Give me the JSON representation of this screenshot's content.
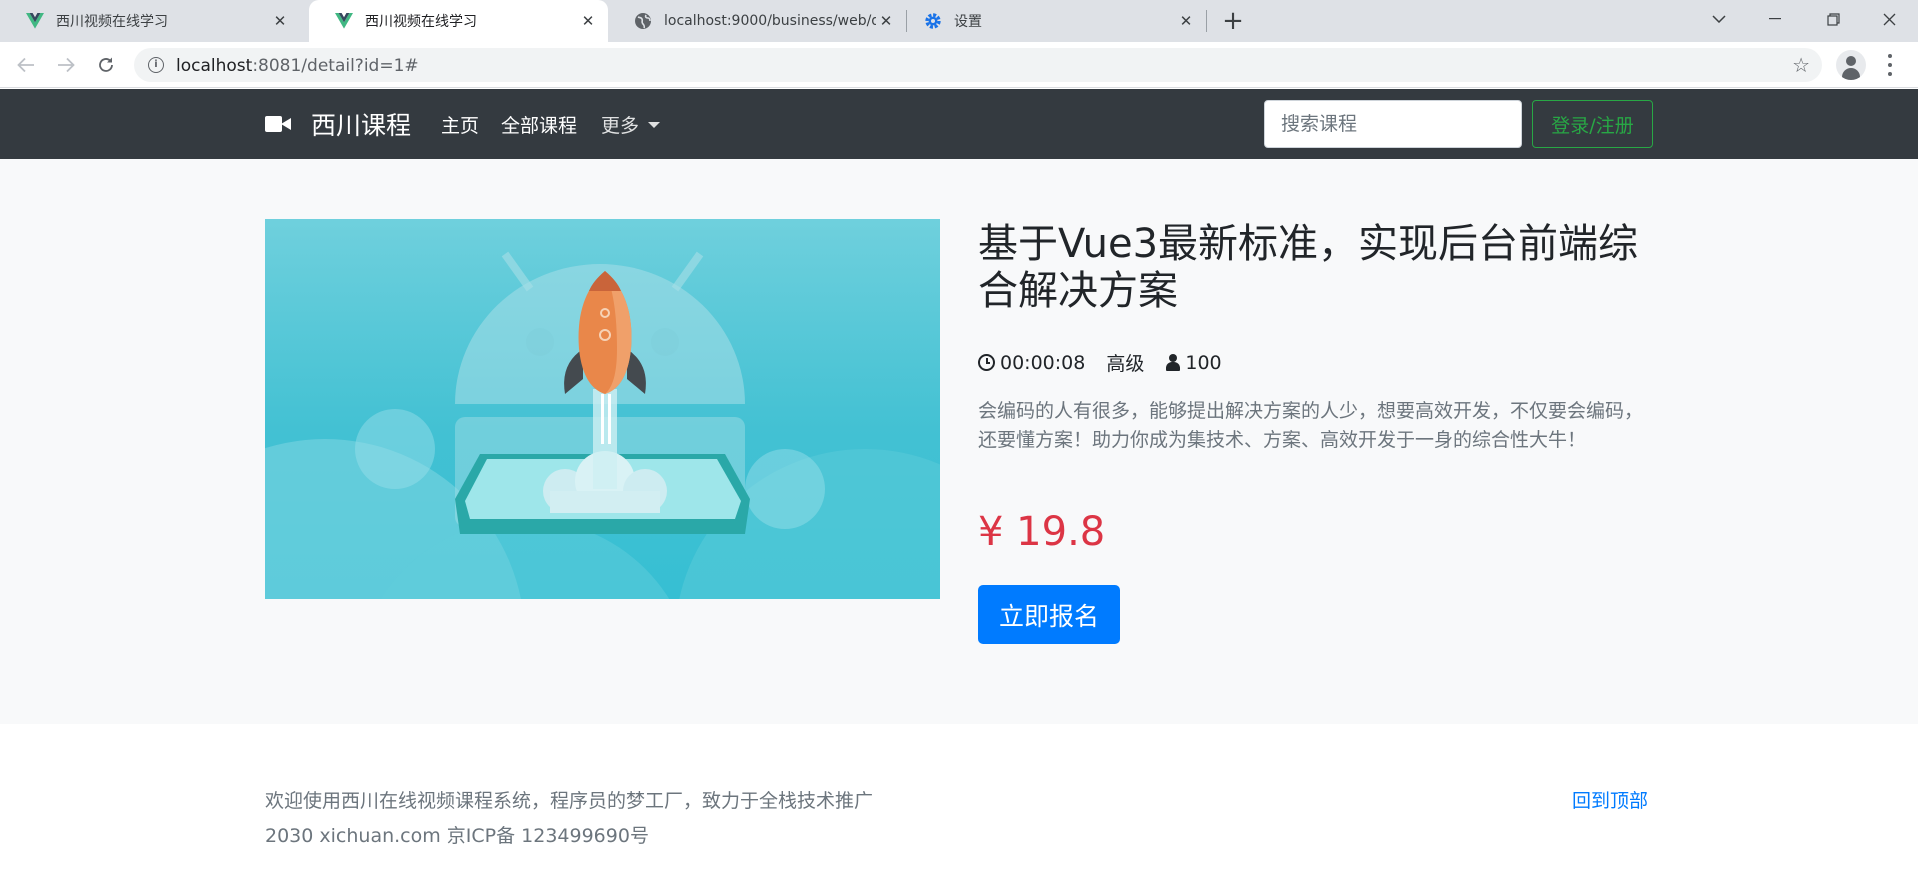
{
  "browser": {
    "tabs": [
      {
        "title": "西川视频在线学习",
        "icon": "vue-logo-icon",
        "active": false
      },
      {
        "title": "西川视频在线学习",
        "icon": "vue-logo-icon",
        "active": true
      },
      {
        "title": "localhost:9000/business/web/d",
        "icon": "globe-icon",
        "active": false
      },
      {
        "title": "设置",
        "icon": "gear-icon",
        "active": false
      }
    ],
    "url_host": "localhost",
    "url_rest": ":8081/detail?id=1#"
  },
  "navbar": {
    "brand": "西川课程",
    "links": [
      "主页",
      "全部课程"
    ],
    "more": "更多",
    "search_placeholder": "搜索课程",
    "login": "登录/注册"
  },
  "course": {
    "title": "基于Vue3最新标准，实现后台前端综合解决方案",
    "duration": "00:00:08",
    "level": "高级",
    "enrolled": "100",
    "description": "会编码的人有很多，能够提出解决方案的人少，想要高效开发，不仅要会编码，还要懂方案！助力你成为集技术、方案、高效开发于一身的综合性大牛！",
    "price": "¥ 19.8",
    "enroll_button": "立即报名"
  },
  "footer": {
    "line1": "欢迎使用西川在线视频课程系统，程序员的梦工厂，致力于全栈技术推广",
    "line2": "2030 xichuan.com  京ICP备 123499690号",
    "back_to_top": "回到顶部"
  },
  "colors": {
    "navbar_bg": "#343a40",
    "price": "#dc3545",
    "primary": "#007bff",
    "login_outline": "#28a745"
  }
}
